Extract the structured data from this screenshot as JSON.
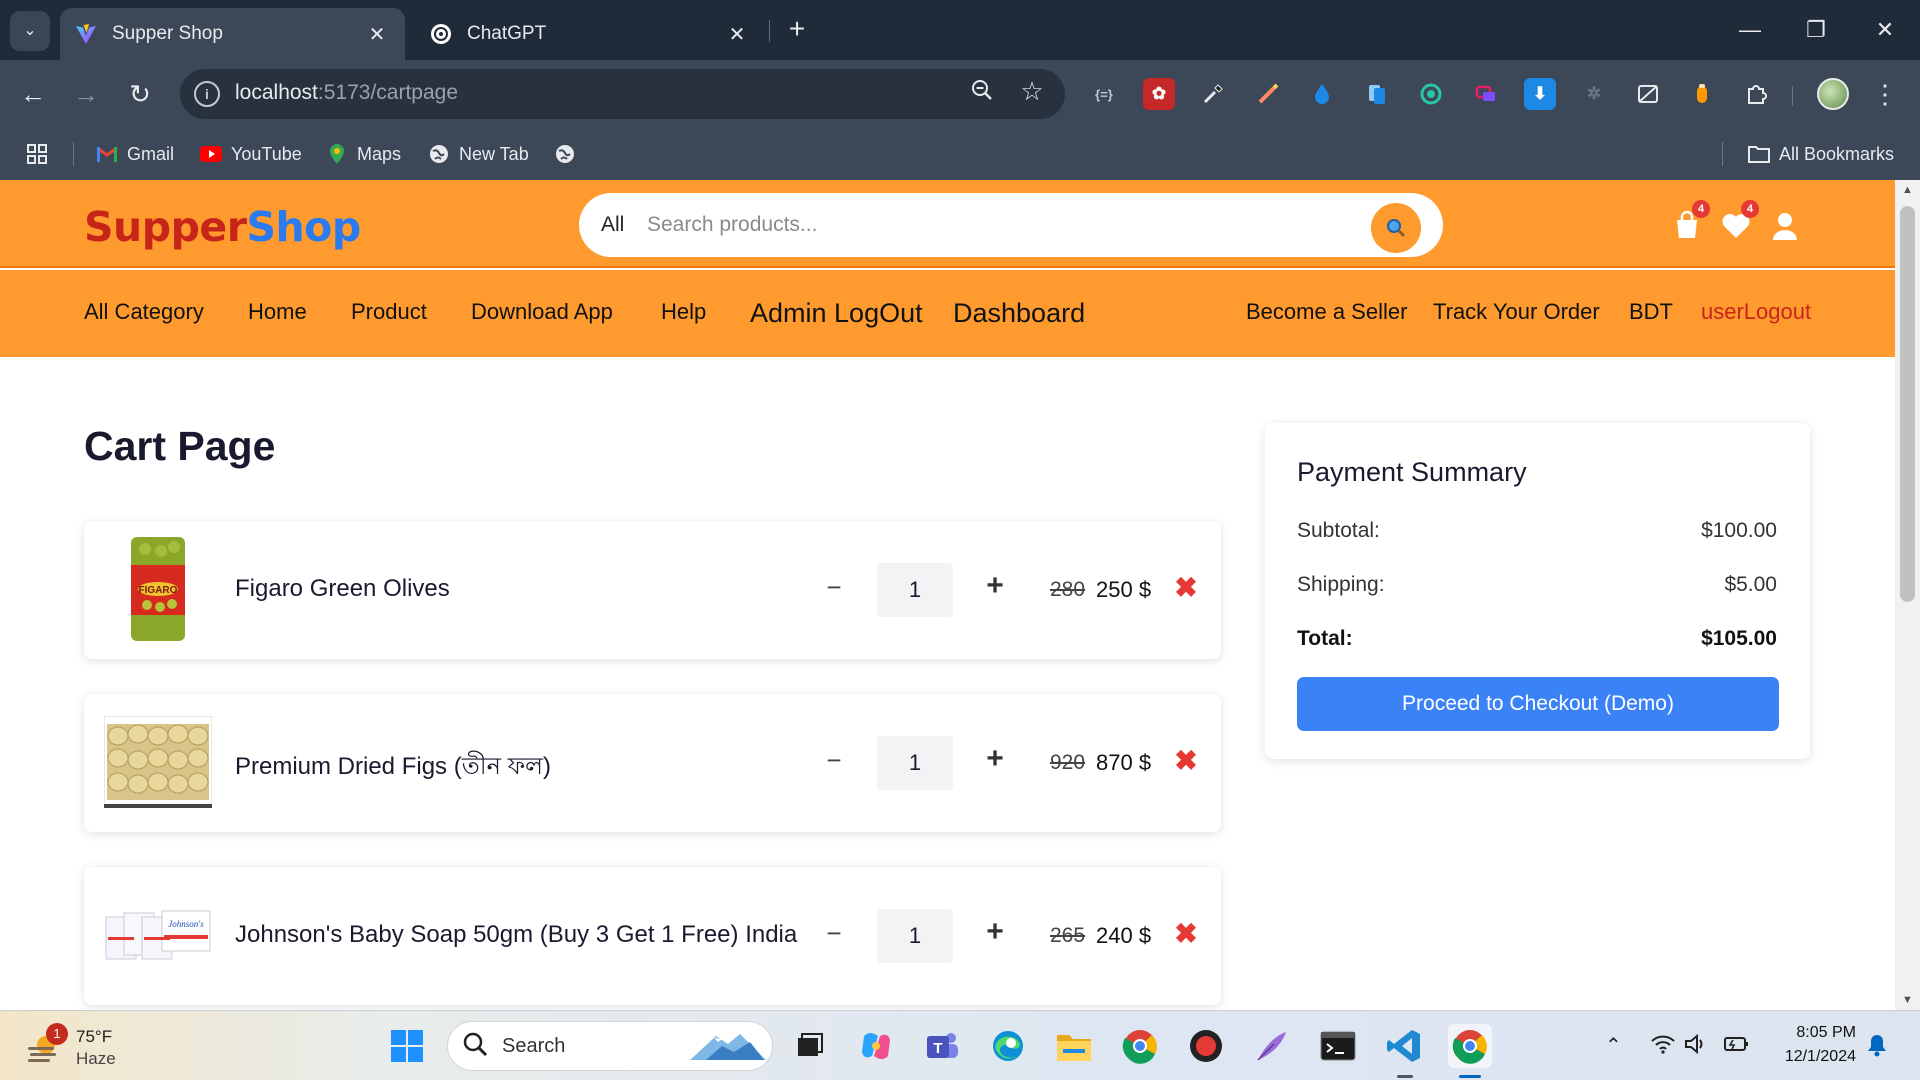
{
  "browser": {
    "tabs": [
      {
        "title": "Supper Shop",
        "active": true
      },
      {
        "title": "ChatGPT",
        "active": false
      }
    ],
    "url_host": "localhost",
    "url_path": ":5173/cartpage",
    "bookmarks": [
      "Gmail",
      "YouTube",
      "Maps",
      "New Tab"
    ],
    "all_bookmarks": "All Bookmarks"
  },
  "site": {
    "logo_part1": "Supper",
    "logo_part2": "Shop",
    "search_scope": "All",
    "search_placeholder": "Search products...",
    "cart_count": "4",
    "wishlist_count": "4",
    "nav": {
      "all_category": "All Category",
      "home": "Home",
      "product": "Product",
      "download_app": "Download App",
      "help": "Help",
      "admin_logout": "Admin LogOut",
      "dashboard": "Dashboard",
      "become_seller": "Become a Seller",
      "track_order": "Track Your Order",
      "currency": "BDT",
      "user_logout": "userLogout"
    },
    "colors": {
      "accent": "#ff9a2e",
      "logo_red": "#c8251a",
      "logo_blue": "#2a7bf0",
      "checkout_blue": "#3b82f6",
      "remove_red": "#e53935"
    }
  },
  "cart": {
    "title": "Cart Page",
    "items": [
      {
        "name": "Figaro Green Olives",
        "qty": "1",
        "old_price": "280",
        "price": "250 $"
      },
      {
        "name": "Premium Dried Figs (তীন ফল)",
        "qty": "1",
        "old_price": "920",
        "price": "870 $"
      },
      {
        "name": "Johnson's Baby Soap 50gm (Buy 3 Get 1 Free) India",
        "qty": "1",
        "old_price": "265",
        "price": "240 $"
      }
    ],
    "controls": {
      "minus": "−",
      "plus": "+",
      "remove": "✖"
    }
  },
  "summary": {
    "title": "Payment Summary",
    "subtotal_label": "Subtotal:",
    "subtotal_value": "$100.00",
    "shipping_label": "Shipping:",
    "shipping_value": "$5.00",
    "total_label": "Total:",
    "total_value": "$105.00",
    "checkout_label": "Proceed to Checkout (Demo)"
  },
  "taskbar": {
    "weather_badge": "1",
    "weather_temp": "75°F",
    "weather_desc": "Haze",
    "search_label": "Search",
    "time": "8:05 PM",
    "date": "12/1/2024"
  }
}
